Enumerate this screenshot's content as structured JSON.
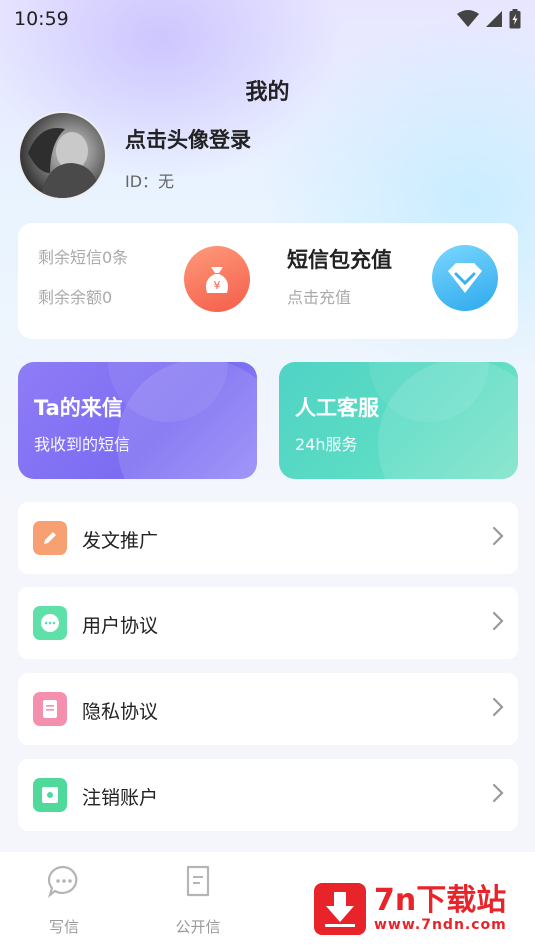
{
  "status_bar": {
    "time": "10:59",
    "icons": [
      "wifi-icon",
      "cellular-icon",
      "battery-charging-icon"
    ]
  },
  "header": {
    "title": "我的"
  },
  "profile": {
    "login_prompt": "点击头像登录",
    "id_text": "ID：无"
  },
  "balance": {
    "sms_left": "剩余短信0条",
    "amount_left": "剩余余额0",
    "recharge_title": "短信包充值",
    "recharge_sub": "点击充值",
    "money_symbol": "¥"
  },
  "feature_cards": [
    {
      "title": "Ta的来信",
      "subtitle": "我收到的短信",
      "color": "#8576f5"
    },
    {
      "title": "人工客服",
      "subtitle": "24h服务",
      "color": "#55d7c5"
    }
  ],
  "menu": [
    {
      "label": "发文推广",
      "icon": "edit-icon",
      "color": "#f7a173"
    },
    {
      "label": "用户协议",
      "icon": "chat-bubble-icon",
      "color": "#5fe0a8"
    },
    {
      "label": "隐私协议",
      "icon": "document-icon",
      "color": "#f58fae"
    },
    {
      "label": "注销账户",
      "icon": "account-box-icon",
      "color": "#4fd99b"
    }
  ],
  "tabbar": [
    {
      "label": "写信",
      "icon": "message-icon"
    },
    {
      "label": "公开信",
      "icon": "letter-icon"
    }
  ],
  "watermark": {
    "brand": "7n下载站",
    "url": "www.7ndn.com"
  }
}
